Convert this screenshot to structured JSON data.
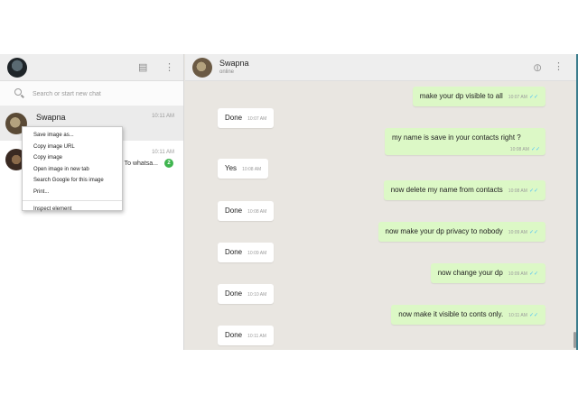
{
  "sidebar": {
    "search_placeholder": "Search or start new chat",
    "chats": [
      {
        "name": "Swapna",
        "time": "10:11 AM"
      },
      {
        "time": "10:11 AM",
        "preview": "... To whatsa...",
        "unread": "2"
      }
    ]
  },
  "context_menu": {
    "items": [
      "Save image as...",
      "Copy image URL",
      "Copy image",
      "Open image in new tab",
      "Search Google for this image",
      "Print..."
    ],
    "inspect": "Inspect element"
  },
  "conversation": {
    "contact_name": "Swapna",
    "status": "online",
    "messages": [
      {
        "dir": "out",
        "text": "make your dp visible to all",
        "time": "10:07 AM",
        "tick": "✓✓"
      },
      {
        "dir": "in",
        "text": "Done",
        "time": "10:07 AM"
      },
      {
        "dir": "out",
        "text": "my name is save in your contacts right ?",
        "time": "10:08 AM",
        "tick": "✓✓"
      },
      {
        "dir": "in",
        "text": "Yes",
        "time": "10:08 AM"
      },
      {
        "dir": "out",
        "text": "now delete my name from contacts",
        "time": "10:08 AM",
        "tick": "✓✓"
      },
      {
        "dir": "in",
        "text": "Done",
        "time": "10:08 AM"
      },
      {
        "dir": "out",
        "text": "now make your dp privacy to nobody",
        "time": "10:09 AM",
        "tick": "✓✓"
      },
      {
        "dir": "in",
        "text": "Done",
        "time": "10:09 AM"
      },
      {
        "dir": "out",
        "text": "now change your dp",
        "time": "10:09 AM",
        "tick": "✓✓"
      },
      {
        "dir": "in",
        "text": "Done",
        "time": "10:10 AM"
      },
      {
        "dir": "out",
        "text": "now make it visible to conts only.",
        "time": "10:11 AM",
        "tick": "✓✓"
      },
      {
        "dir": "in",
        "text": "Done",
        "time": "10:11 AM"
      }
    ]
  },
  "colors": {
    "outgoing_bubble": "#dcf8c6",
    "incoming_bubble": "#ffffff",
    "unread_badge": "#3fb54f",
    "read_ticks": "#4fc3f7"
  }
}
